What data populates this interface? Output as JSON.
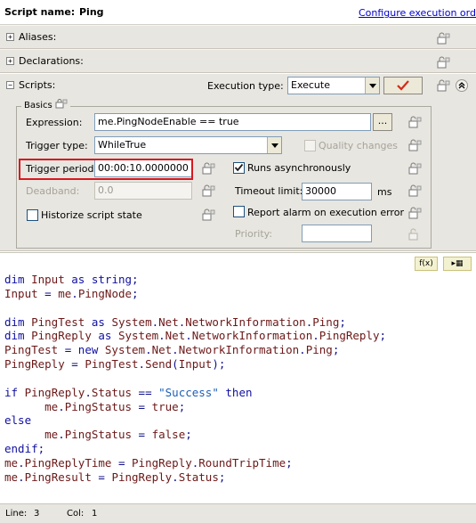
{
  "header": {
    "script_name_label": "Script name:",
    "script_name_value": "Ping",
    "configure_link": "Configure execution order"
  },
  "sections": {
    "aliases": {
      "expander": "+",
      "label": "Aliases:"
    },
    "declarations": {
      "expander": "+",
      "label": "Declarations:"
    },
    "scripts": {
      "expander": "−",
      "label": "Scripts:"
    }
  },
  "scripts": {
    "execution_type_label": "Execution type:",
    "execution_type_value": "Execute",
    "confirm_icon": "checkmark-icon",
    "collapse_icon": "double-chevron-up-icon"
  },
  "basics": {
    "title": "Basics",
    "expression_label": "Expression:",
    "expression_value": "me.PingNodeEnable == true",
    "browse_label": "...",
    "trigger_type_label": "Trigger type:",
    "trigger_type_value": "WhileTrue",
    "quality_changes_label": "Quality changes",
    "quality_changes_checked": false,
    "trigger_period_label": "Trigger period:",
    "trigger_period_value": "00:00:10.0000000",
    "runs_async_label": "Runs asynchronously",
    "runs_async_checked": true,
    "deadband_label": "Deadband:",
    "deadband_value": "0.0",
    "timeout_label": "Timeout limit:",
    "timeout_value": "30000",
    "timeout_unit": "ms",
    "historize_label": "Historize script state",
    "historize_checked": false,
    "report_alarm_label": "Report alarm on execution error",
    "report_alarm_checked": false,
    "priority_label": "Priority:",
    "priority_value": ""
  },
  "editor_toolbar": {
    "function_button": "f(x)",
    "insert_button": "▸▦"
  },
  "code_lines": [
    "dim Input as string;",
    "Input = me.PingNode;",
    "",
    "dim PingTest as System.Net.NetworkInformation.Ping;",
    "dim PingReply as System.Net.NetworkInformation.PingReply;",
    "PingTest = new System.Net.NetworkInformation.Ping;",
    "PingReply = PingTest.Send(Input);",
    "",
    "if PingReply.Status == \"Success\" then",
    "      me.PingStatus = true;",
    "else",
    "      me.PingStatus = false;",
    "endif;",
    "me.PingReplyTime = PingReply.RoundTripTime;",
    "me.PingResult = PingReply.Status;"
  ],
  "status": {
    "line_label": "Line:",
    "line_value": "3",
    "col_label": "Col:",
    "col_value": "1"
  },
  "colors": {
    "panel_bg": "#e8e6e0",
    "highlight_border": "#d71920",
    "link": "#0000cc",
    "code_text": "#10108a",
    "string_literal": "#1d60b6"
  }
}
